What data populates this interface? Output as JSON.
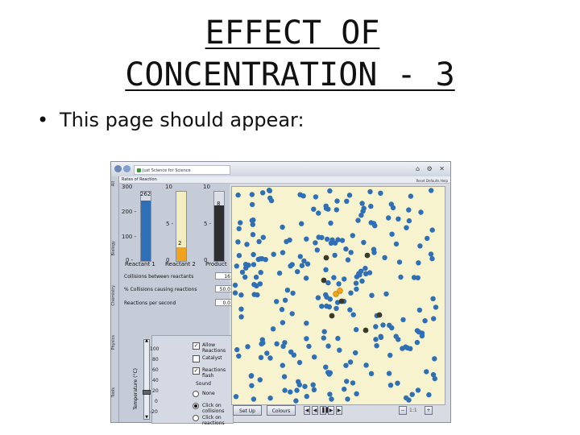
{
  "slide": {
    "title_line1": "EFFECT OF",
    "title_line2": "CONCENTRATION - 3",
    "bullet": "•",
    "bullet_text": "This page should appear:"
  },
  "screenshot": {
    "browser_tab": "Just Science for Science",
    "browser_right": "⌂ ⚙ ✕",
    "app_title": "Rates of Reaction",
    "app_buttons": "Reset Defaults   Help",
    "side_tabs": [
      "All",
      "Biology",
      "Chemistry",
      "Physics",
      "Tools"
    ],
    "chart": {
      "left_axis_top": "300",
      "left_axis_ticks": [
        "200 -",
        "100 -",
        "0 -"
      ],
      "col2_top": "10",
      "col2_ticks": [
        "5 -",
        "0"
      ],
      "col3_top": "10",
      "col3_ticks": [
        "5 -",
        "0"
      ],
      "bars": [
        {
          "label": "Reactant 1",
          "value_label": "262",
          "value": 262,
          "max": 300,
          "color": "#2f6fb6"
        },
        {
          "label": "Reactant 2",
          "value_label": "2",
          "value": 2,
          "max": 10,
          "color": "#f0a31c"
        },
        {
          "label": "Product",
          "value_label": "8",
          "value": 8,
          "max": 10,
          "color": "#2e2e2e"
        }
      ]
    },
    "fields": [
      {
        "label": "Collisions between reactants",
        "value": "16"
      },
      {
        "label": "% Collisions causing reactions",
        "value": "50.0"
      },
      {
        "label": "Reactions per second",
        "value": "0.0"
      }
    ],
    "temperature": {
      "axis_label": "Temperature (°C)",
      "ticks": [
        "100",
        "80",
        "60",
        "40",
        "20",
        "0",
        "-20"
      ],
      "level": 20
    },
    "options": {
      "allow_reactions": "Allow Reactions",
      "catalyst": "Catalyst",
      "reactions_flash": "Reactions flash",
      "sound_label": "Sound",
      "none": "None",
      "click_collisions": "Click on collisions",
      "click_reactions": "Click on reactions",
      "allow_reactions_checked": true,
      "catalyst_checked": false,
      "reactions_flash_checked": true,
      "sound_selected": "Click on collisions"
    },
    "bottom": {
      "setup_label": "Set Up",
      "colours_label": "Colours",
      "transport": [
        "◀",
        "◀",
        "▐▐",
        "▶",
        "▶"
      ],
      "zoom_minus": "−",
      "zoom_value": "1:1",
      "zoom_plus": "+"
    },
    "colors": {
      "particle_reactant1": "#2f6fb6",
      "particle_product": "#3a3a2a",
      "particle_reactant2": "#f0a31c",
      "sim_background": "#f7f3cf"
    }
  }
}
